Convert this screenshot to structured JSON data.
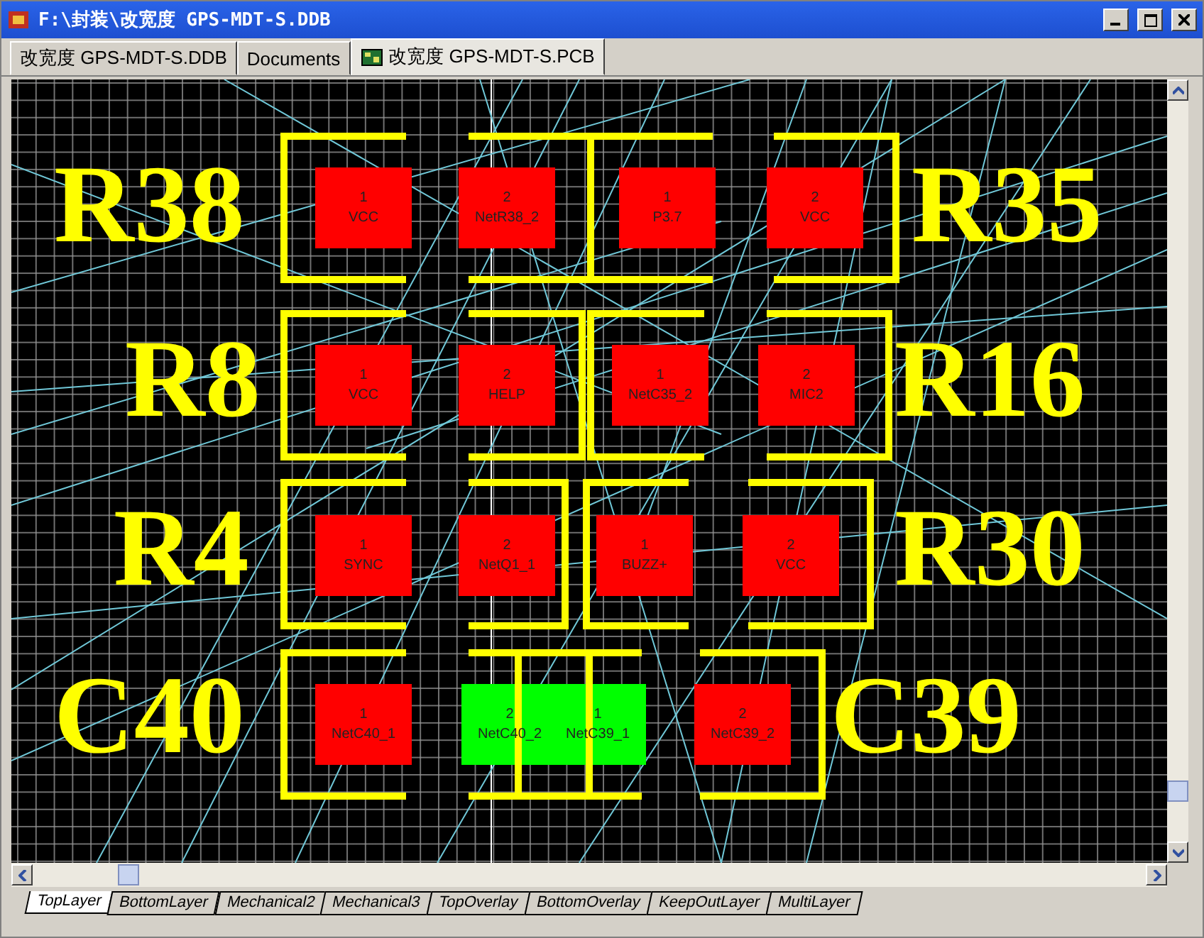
{
  "window": {
    "title": "F:\\封装\\改宽度 GPS-MDT-S.DDB"
  },
  "document_tabs": [
    {
      "label": "改宽度 GPS-MDT-S.DDB",
      "selected": false,
      "icon": false
    },
    {
      "label": "Documents",
      "selected": false,
      "icon": false
    },
    {
      "label": "改宽度 GPS-MDT-S.PCB",
      "selected": true,
      "icon": true
    }
  ],
  "components": [
    {
      "designator": "R38",
      "pads": [
        {
          "number": "1",
          "net": "VCC",
          "color": "#ff0000"
        },
        {
          "number": "2",
          "net": "NetR38_2",
          "color": "#ff0000"
        }
      ]
    },
    {
      "designator": "R35",
      "pads": [
        {
          "number": "1",
          "net": "P3.7",
          "color": "#ff0000"
        },
        {
          "number": "2",
          "net": "VCC",
          "color": "#ff0000"
        }
      ]
    },
    {
      "designator": "R8",
      "pads": [
        {
          "number": "1",
          "net": "VCC",
          "color": "#ff0000"
        },
        {
          "number": "2",
          "net": "HELP",
          "color": "#ff0000"
        }
      ]
    },
    {
      "designator": "R16",
      "pads": [
        {
          "number": "1",
          "net": "NetC35_2",
          "color": "#ff0000"
        },
        {
          "number": "2",
          "net": "MIC2",
          "color": "#ff0000"
        }
      ]
    },
    {
      "designator": "R4",
      "pads": [
        {
          "number": "1",
          "net": "SYNC",
          "color": "#ff0000"
        },
        {
          "number": "2",
          "net": "NetQ1_1",
          "color": "#ff0000"
        }
      ]
    },
    {
      "designator": "R30",
      "pads": [
        {
          "number": "1",
          "net": "BUZZ+",
          "color": "#ff0000"
        },
        {
          "number": "2",
          "net": "VCC",
          "color": "#ff0000"
        }
      ]
    },
    {
      "designator": "C40",
      "pads": [
        {
          "number": "1",
          "net": "NetC40_1",
          "color": "#ff0000"
        },
        {
          "number": "2",
          "net": "NetC40_2",
          "color": "#00ff00"
        }
      ]
    },
    {
      "designator": "C39",
      "pads": [
        {
          "number": "1",
          "net": "NetC39_1",
          "color": "#00ff00"
        },
        {
          "number": "2",
          "net": "NetC39_2",
          "color": "#ff0000"
        }
      ]
    }
  ],
  "layer_tabs": [
    {
      "label": "TopLayer",
      "selected": true
    },
    {
      "label": "BottomLayer",
      "selected": false
    },
    {
      "label": "Mechanical2",
      "selected": false
    },
    {
      "label": "Mechanical3",
      "selected": false
    },
    {
      "label": "TopOverlay",
      "selected": false
    },
    {
      "label": "BottomOverlay",
      "selected": false
    },
    {
      "label": "KeepOutLayer",
      "selected": false
    },
    {
      "label": "MultiLayer",
      "selected": false
    }
  ]
}
